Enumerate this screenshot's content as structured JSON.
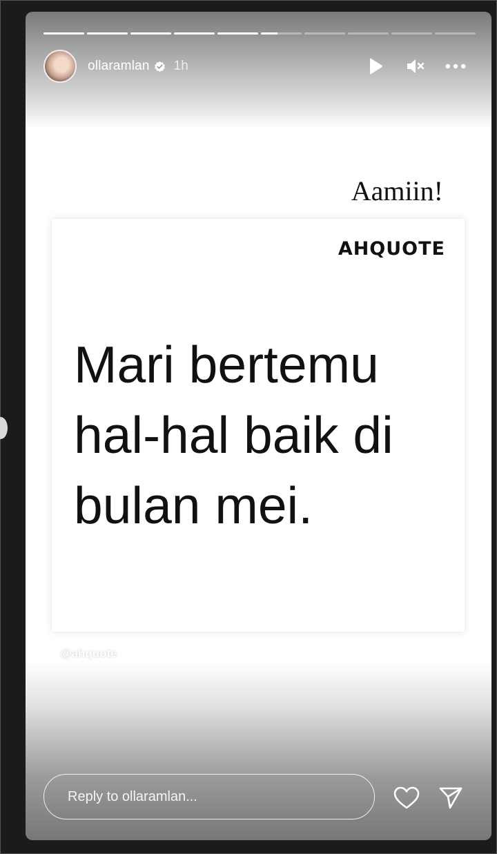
{
  "story": {
    "progress": {
      "segments_total": 10,
      "completed": 5,
      "current_fraction": 0.4
    },
    "header": {
      "username": "ollaramlan",
      "verified": true,
      "time": "1h",
      "icons": [
        "play-icon",
        "mute-icon",
        "more-icon"
      ]
    },
    "caption": "Aamiin!",
    "quote_card": {
      "brand": "AHQUOTE",
      "text": "Mari bertemu hal-hal baik di bulan mei."
    },
    "watermark": "@ahquote",
    "reply": {
      "placeholder": "Reply to ollaramlan..."
    },
    "footer_icons": [
      "heart-icon",
      "send-icon"
    ]
  },
  "colors": {
    "frame": "#1b1b1b",
    "text_dark": "#111111",
    "text_light": "#ffffff"
  }
}
